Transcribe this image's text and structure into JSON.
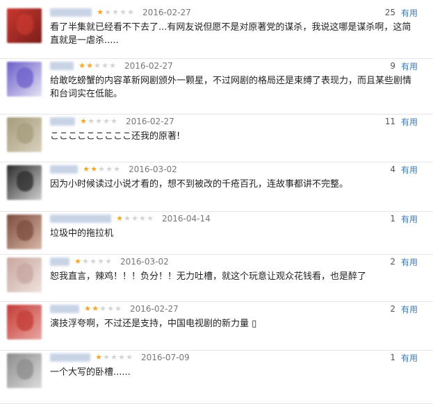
{
  "reviews": [
    {
      "stars": 1,
      "date": "2016-02-27",
      "count": "25",
      "useful": "有用",
      "text": "看了半集就已经看不下去了...有网友说但愿不是对原著党的谋杀，我说这哪是谋杀啊，这简直就是一虐杀.....",
      "avatar": [
        "#c9382f",
        "#7a1e1c"
      ],
      "name_width": 60
    },
    {
      "stars": 2,
      "date": "2016-02-27",
      "count": "9",
      "useful": "有用",
      "text": "给敢吃螃蟹的内容革新网剧颁外一颗星，不过网剧的格局还是束缚了表现力，而且某些剧情和台词实在低能。",
      "avatar": [
        "#6b5ec9",
        "#e4e2f4"
      ],
      "name_width": 34
    },
    {
      "stars": 1,
      "date": "2016-02-27",
      "count": "11",
      "useful": "有用",
      "text": "こここここここここ还我的原著!",
      "avatar": [
        "#a59b7c",
        "#d8d1bc"
      ],
      "name_width": 36
    },
    {
      "stars": 2,
      "date": "2016-03-02",
      "count": "4",
      "useful": "有用",
      "text": "因为小时候读过小说才看的，想不到被改的千疮百孔，连故事都讲不完整。",
      "avatar": [
        "#2b2b2b",
        "#cfcfcf"
      ],
      "name_width": 40
    },
    {
      "stars": 1,
      "date": "2016-04-14",
      "count": "1",
      "useful": "有用",
      "text": "垃圾中的拖拉机",
      "avatar": [
        "#7b4c3e",
        "#d8b6a6"
      ],
      "name_width": 88
    },
    {
      "stars": 1,
      "date": "2016-03-02",
      "count": "2",
      "useful": "有用",
      "text": "恕我直言，辣鸡！！！负分！！无力吐槽，就这个玩意让观众花钱看，也是醉了",
      "avatar": [
        "#c8a6a0",
        "#efe1dc"
      ],
      "name_width": 28
    },
    {
      "stars": 2,
      "date": "2016-02-27",
      "count": "2",
      "useful": "有用",
      "text": "演技浮夸啊，不过还是支持，中国电视剧的新力量 ▯",
      "avatar": [
        "#c43b36",
        "#e9a7a2"
      ],
      "name_width": 42
    },
    {
      "stars": 1,
      "date": "2016-07-09",
      "count": "1",
      "useful": "有用",
      "text": "一个大写的卧槽......",
      "avatar": [
        "#8c8c8c",
        "#dcdcdc"
      ],
      "name_width": 58
    }
  ]
}
